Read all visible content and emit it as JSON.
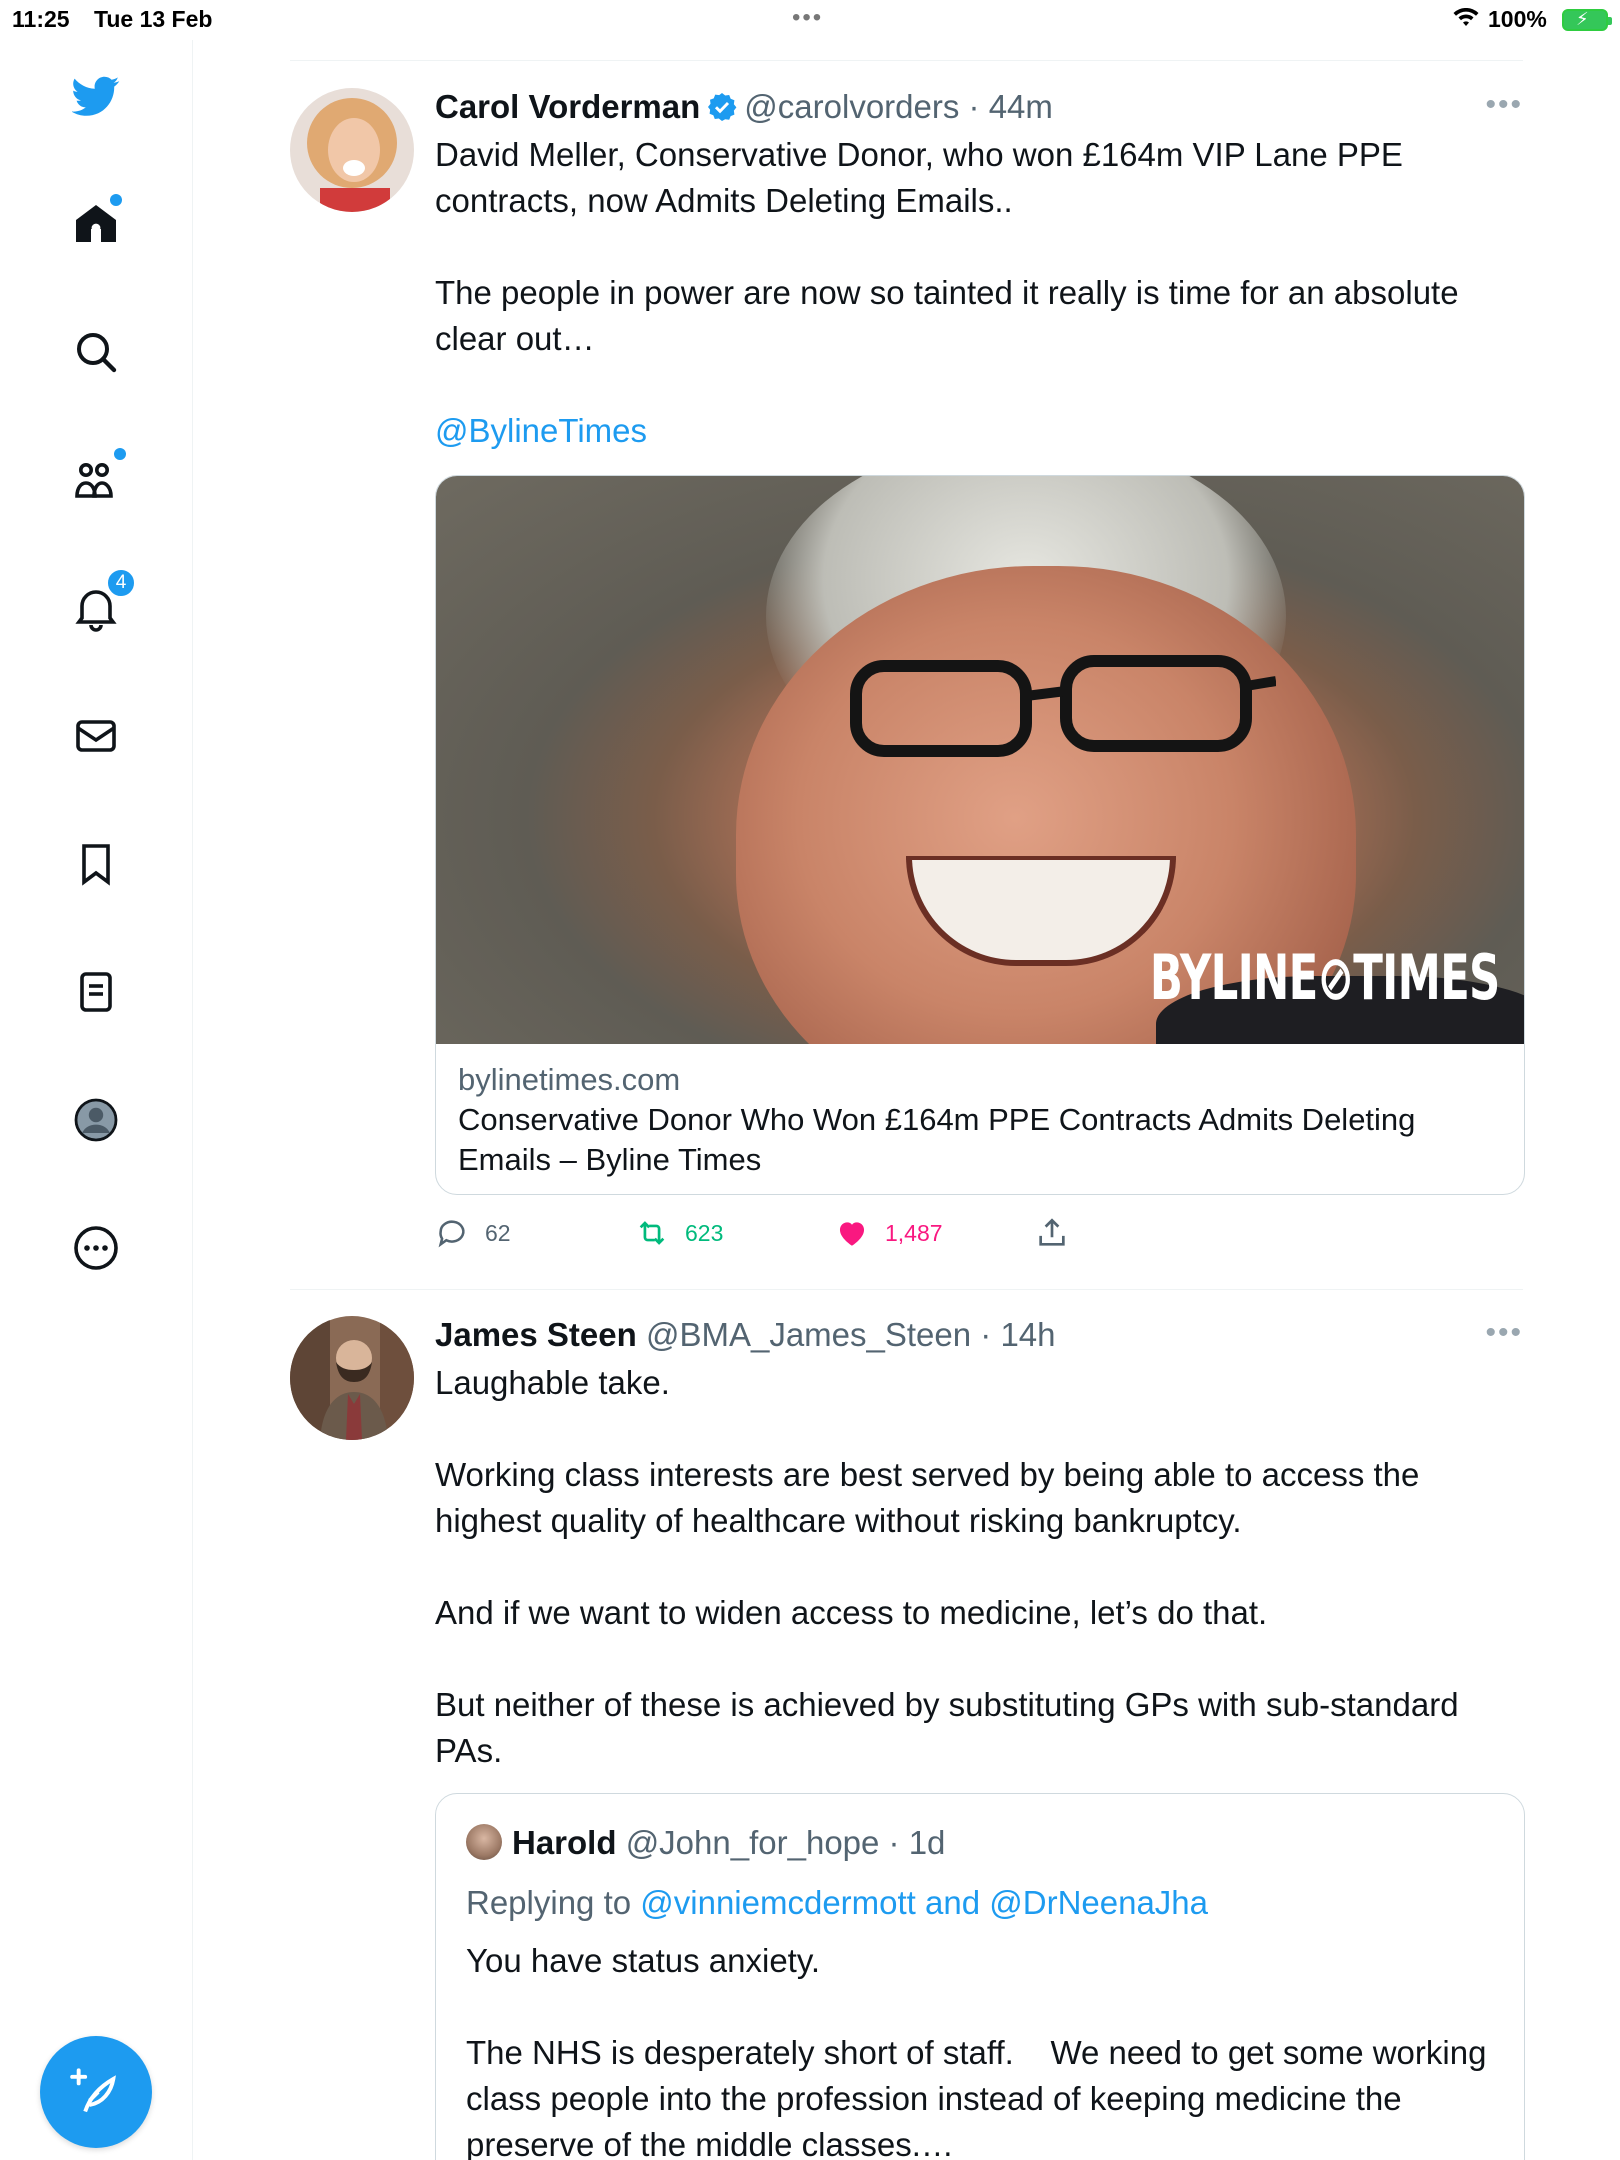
{
  "status_bar": {
    "time": "11:25",
    "date": "Tue 13 Feb",
    "battery_percent": "100%"
  },
  "sidebar": {
    "notifications_badge": "4",
    "items": [
      "home-icon",
      "search-icon",
      "communities-icon",
      "notifications-icon",
      "messages-icon",
      "bookmarks-icon",
      "lists-icon",
      "profile-icon",
      "more-icon"
    ]
  },
  "colors": {
    "accent": "#1d9bf0",
    "like": "#f91880",
    "retweet": "#00ba7c",
    "text": "#0f1419",
    "muted": "#536471"
  },
  "tweets": [
    {
      "name": "Carol Vorderman",
      "handle": "@carolvorders",
      "time": "44m",
      "text": "David Meller, Conservative Donor, who won £164m VIP Lane PPE contracts, now Admits Deleting Emails..\n\nThe people in power are now so tainted it really is time for an absolute clear out…",
      "mention": "@BylineTimes",
      "card": {
        "image_brand": "BYLINE⊘TIMES",
        "domain": "bylinetimes.com",
        "title": "Conservative Donor Who Won £164m PPE Contracts Admits Deleting Emails – Byline Times"
      },
      "replies": "62",
      "retweets": "623",
      "likes": "1,487"
    },
    {
      "name": "James Steen",
      "handle": "@BMA_James_Steen",
      "time": "14h",
      "text": "Laughable take.\n\nWorking class interests are best served by being able to access the highest quality of healthcare without risking bankruptcy.\n\nAnd if we want to widen access to medicine, let’s do that.\n\nBut neither of these is achieved by substituting GPs with sub-standard PAs.",
      "quote": {
        "name": "Harold",
        "handle": "@John_for_hope",
        "time": "1d",
        "replying_prefix": "Replying to ",
        "replying_to": "@vinniemcdermott and @DrNeenaJha",
        "text": "You have status anxiety.\n\nThe NHS is desperately short of staff.    We need to get some working class people into the profession instead of keeping medicine the preserve of the middle classes.…"
      }
    }
  ]
}
